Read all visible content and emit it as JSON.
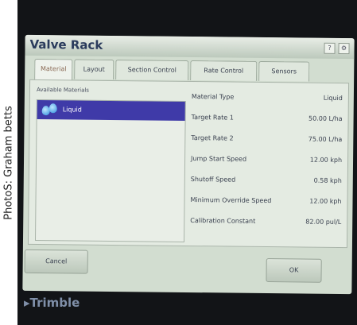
{
  "photo_credit": "PhotoS: Graham betts",
  "brand": "Trimble",
  "window": {
    "title": "Valve Rack",
    "icons": [
      "help-icon",
      "settings-icon"
    ]
  },
  "tabs": [
    {
      "label": "Material",
      "active": true
    },
    {
      "label": "Layout",
      "active": false
    },
    {
      "label": "Section Control",
      "active": false
    },
    {
      "label": "Rate Control",
      "active": false
    },
    {
      "label": "Sensors",
      "active": false
    }
  ],
  "materials": {
    "heading": "Available Materials",
    "items": [
      {
        "label": "Liquid",
        "icon": "liquid-drops-icon",
        "selected": true
      }
    ]
  },
  "properties": [
    {
      "name": "Material Type",
      "value": "Liquid"
    },
    {
      "name": "Target Rate 1",
      "value": "50.00 L/ha"
    },
    {
      "name": "Target Rate 2",
      "value": "75.00 L/ha"
    },
    {
      "name": "Jump Start Speed",
      "value": "12.00 kph"
    },
    {
      "name": "Shutoff Speed",
      "value": "0.58 kph"
    },
    {
      "name": "Minimum Override Speed",
      "value": "12.00 kph"
    },
    {
      "name": "Calibration Constant",
      "value": "82.00 pul/L"
    }
  ],
  "buttons": {
    "cancel": "Cancel",
    "ok": "OK"
  },
  "colors": {
    "selection": "#3f3aa8",
    "screen": "#d2ddd0",
    "bezel": "#121417"
  }
}
